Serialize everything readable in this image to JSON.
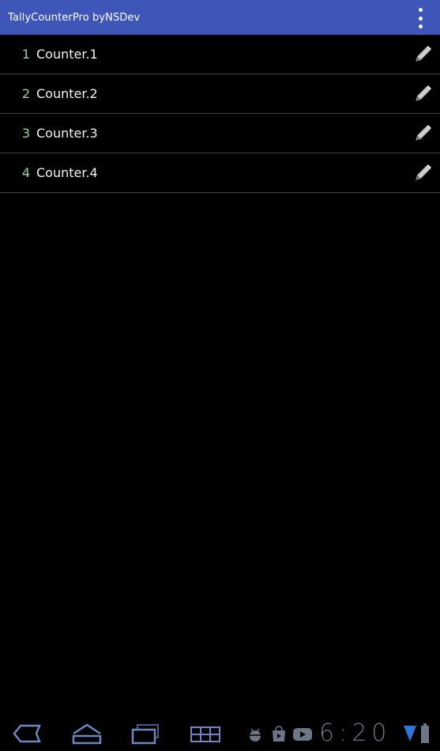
{
  "app": {
    "title": "TallyCounterPro byNSDev"
  },
  "counters": [
    {
      "number": "1",
      "label": "Counter.1"
    },
    {
      "number": "2",
      "label": "Counter.2"
    },
    {
      "number": "3",
      "label": "Counter.3"
    },
    {
      "number": "4",
      "label": "Counter.4"
    }
  ],
  "status": {
    "time": "6:20"
  },
  "colors": {
    "action_bar": "#3d56b8",
    "number": "#9ad69a",
    "nav": "#6f86c2"
  },
  "icons": {
    "overflow": "overflow-menu-icon",
    "edit": "pencil-icon",
    "back": "back-icon",
    "home": "home-icon",
    "recents": "recent-apps-icon",
    "menu": "menu-grid-icon"
  }
}
